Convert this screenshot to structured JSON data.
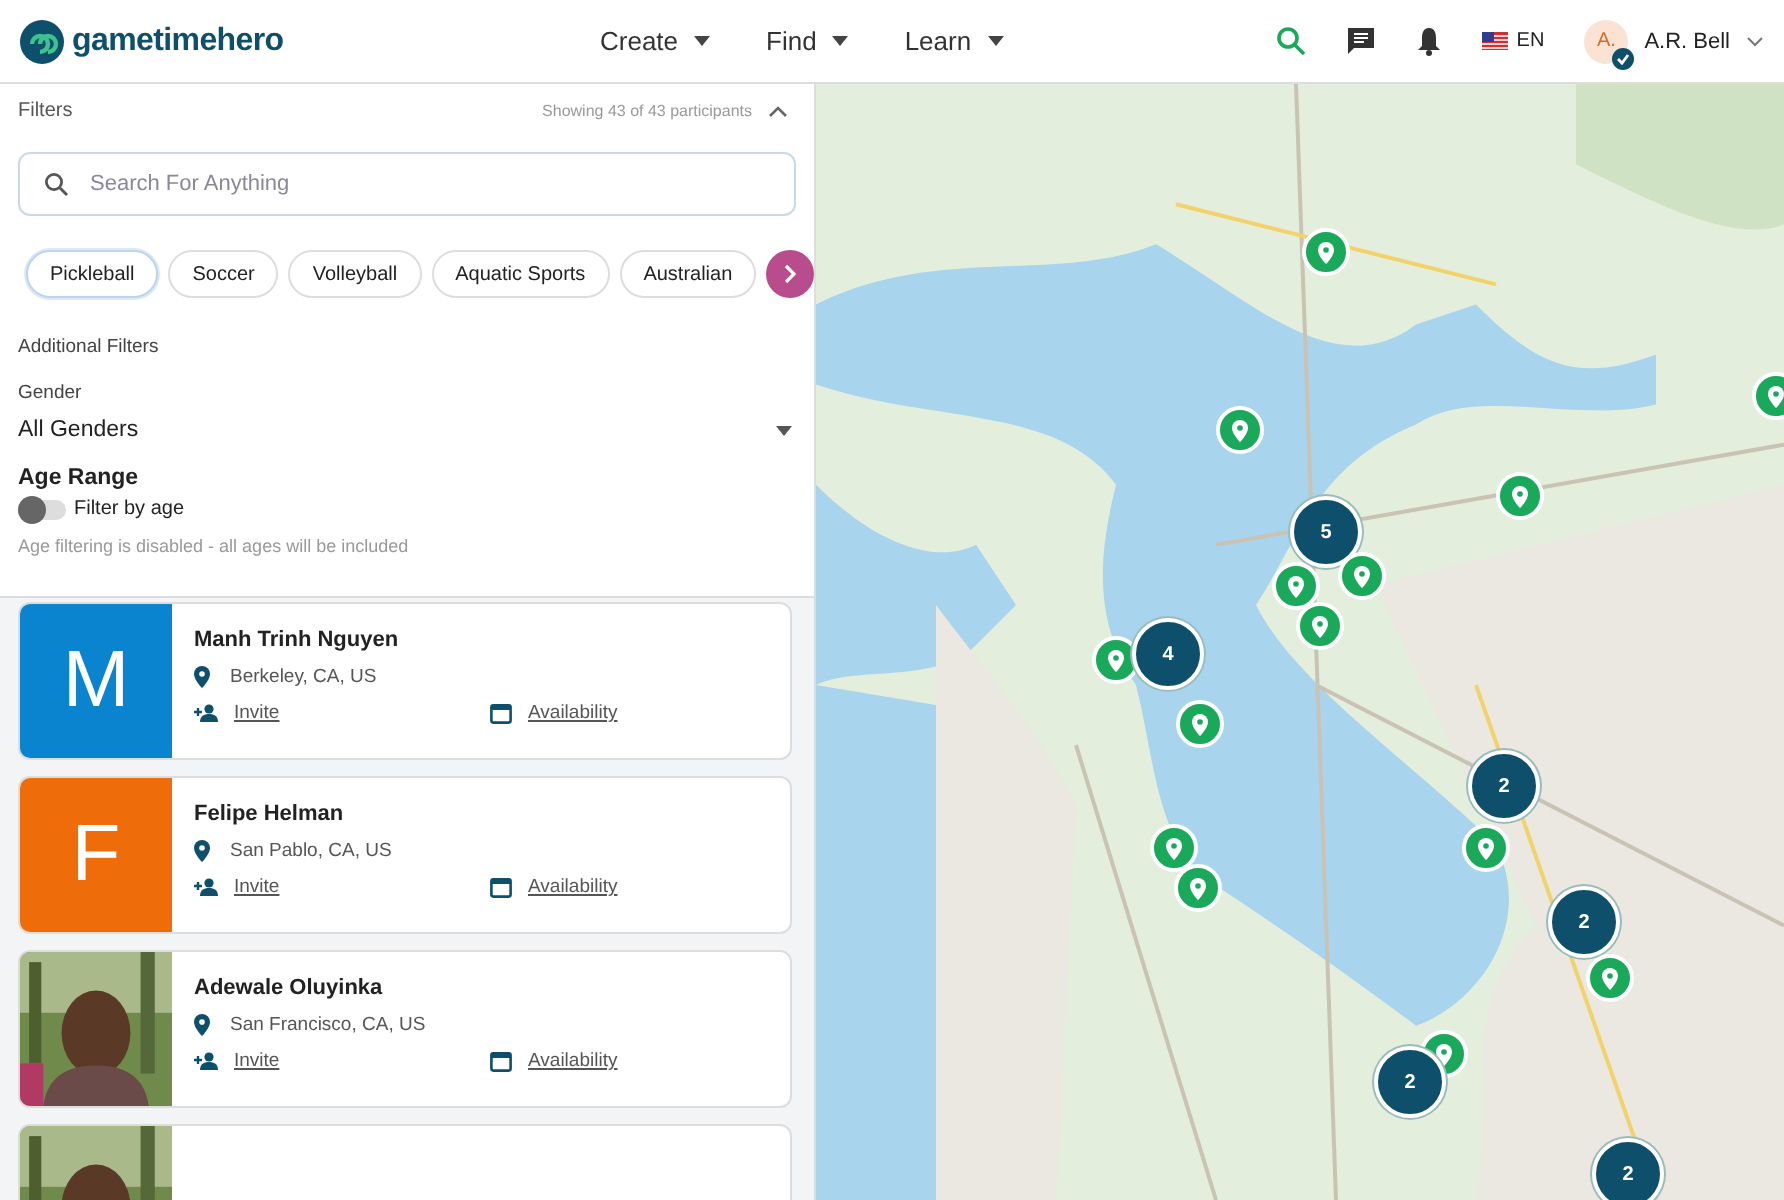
{
  "header": {
    "logo": "gametimehero",
    "nav": [
      {
        "label": "Create"
      },
      {
        "label": "Find"
      },
      {
        "label": "Learn"
      }
    ],
    "language": "EN",
    "user": {
      "initials": "A.",
      "name": "A.R. Bell",
      "verified": true
    }
  },
  "filters": {
    "title": "Filters",
    "summary": "Showing 43 of 43 participants",
    "expanded": true,
    "search": {
      "placeholder": "Search For Anything"
    },
    "sports": [
      {
        "label": "Pickleball",
        "selected": true
      },
      {
        "label": "Soccer",
        "selected": false
      },
      {
        "label": "Volleyball",
        "selected": false
      },
      {
        "label": "Aquatic Sports",
        "selected": false
      },
      {
        "label": "Australian",
        "selected": false
      }
    ],
    "additional_title": "Additional Filters",
    "gender_label": "Gender",
    "gender_value": "All Genders",
    "age_title": "Age Range",
    "age_toggle": {
      "label": "Filter by age",
      "on": false
    },
    "age_note": "Age filtering is disabled - all ages will be included"
  },
  "participants": [
    {
      "avatar": {
        "kind": "letter",
        "letter": "M",
        "color": "#0b84d0"
      },
      "name": "Manh Trinh Nguyen",
      "location": "Berkeley, CA, US",
      "invite": "Invite",
      "availability": "Availability"
    },
    {
      "avatar": {
        "kind": "letter",
        "letter": "F",
        "color": "#ef6c0a"
      },
      "name": "Felipe Helman",
      "location": "San Pablo, CA, US",
      "invite": "Invite",
      "availability": "Availability"
    },
    {
      "avatar": {
        "kind": "picture"
      },
      "name": "Adewale Oluyinka",
      "location": "San Francisco, CA, US",
      "invite": "Invite",
      "availability": "Availability"
    },
    {
      "avatar": {
        "kind": "picture"
      }
    }
  ],
  "map": {
    "markers": [
      {
        "kind": "pin"
      },
      {
        "kind": "pin"
      },
      {
        "kind": "pin"
      },
      {
        "kind": "pin"
      },
      {
        "kind": "cluster",
        "count": "5"
      },
      {
        "kind": "pin"
      },
      {
        "kind": "pin"
      },
      {
        "kind": "pin"
      },
      {
        "kind": "pin"
      },
      {
        "kind": "cluster",
        "count": "4"
      },
      {
        "kind": "pin"
      },
      {
        "kind": "cluster",
        "count": "2"
      },
      {
        "kind": "pin"
      },
      {
        "kind": "pin"
      },
      {
        "kind": "pin"
      },
      {
        "kind": "cluster",
        "count": "2"
      },
      {
        "kind": "pin"
      },
      {
        "kind": "pin"
      },
      {
        "kind": "cluster",
        "count": "2"
      },
      {
        "kind": "cluster",
        "count": "2"
      }
    ]
  }
}
